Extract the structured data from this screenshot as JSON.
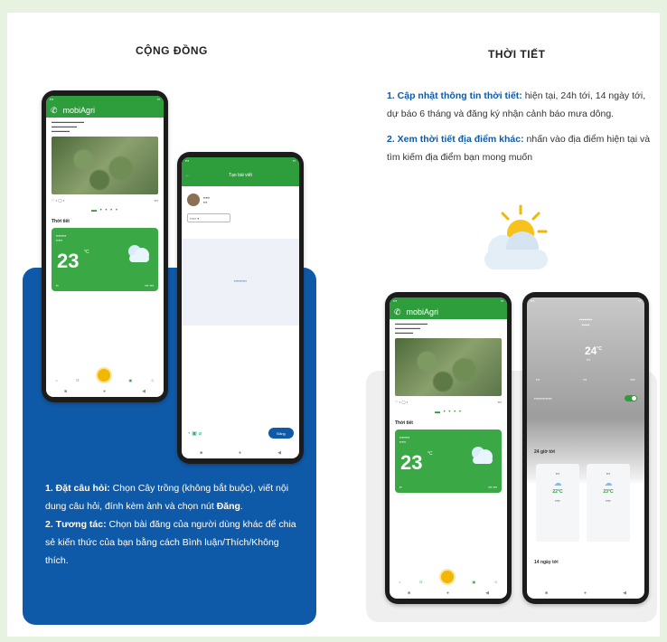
{
  "left_section": {
    "title": "CỘNG ĐỒNG",
    "instructions": {
      "p1_bold": "1. Đặt câu hỏi:",
      "p1_text": " Chọn Cây trồng (không bắt buộc), viết nội dung câu hỏi, đính kèm ảnh và chọn nút ",
      "p1_bold2": "Đăng",
      "p1_end": ".",
      "p2_bold": "2. Tương tác:",
      "p2_text": " Chọn bài đăng của người dùng khác để chia sẻ kiến thức của bạn bằng cách Bình luận/Thích/Không thích."
    }
  },
  "right_section": {
    "title": "THỜI TIẾT",
    "instructions": {
      "p1_bold": "1. Cập nhật thông tin thời tiết:",
      "p1_text": " hiện tại, 24h tới, 14 ngày tới, dự báo 6 tháng và đăng ký nhận cảnh báo mưa dông.",
      "p2_bold": "2. Xem thời tiết địa điểm khác:",
      "p2_text": " nhấn vào địa điểm hiện tại và tìm kiếm địa điểm bạn mong muốn"
    }
  },
  "app": {
    "name": "mobiAgri",
    "weather_label": "Thời tiết",
    "temperature": "23",
    "temp_unit": "°C",
    "post_screen_title": "Tạo bài viết",
    "post_button": "Đăng",
    "detail_temp": "24",
    "detail_temp_unit": "°C",
    "hourly_label": "24 giờ tới",
    "daily_label": "14 ngày tới",
    "hour_temp_1": "22°C",
    "hour_temp_2": "23°C"
  },
  "colors": {
    "primary_green": "#2e9e3c",
    "panel_blue": "#0f5aa8",
    "fab_yellow": "#f2b705"
  }
}
